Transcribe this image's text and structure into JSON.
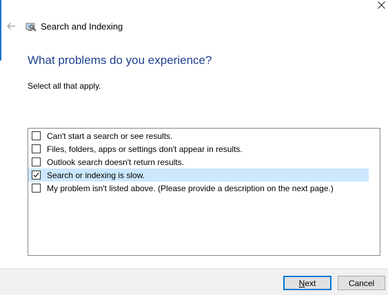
{
  "window": {
    "title": "Search and Indexing",
    "close_icon": "close-icon",
    "back_icon": "back-arrow-icon",
    "app_icon": "troubleshooter-icon",
    "accent_color": "#1a73c8"
  },
  "page": {
    "heading": "What problems do you experience?",
    "heading_color": "#1e3f8f",
    "instruction": "Select all that apply."
  },
  "problems": [
    {
      "label": "Can't start a search or see results.",
      "checked": false
    },
    {
      "label": "Files, folders, apps or settings don't appear in results.",
      "checked": false
    },
    {
      "label": "Outlook search doesn't return results.",
      "checked": false
    },
    {
      "label": "Search or indexing is slow.",
      "checked": true
    },
    {
      "label": "My problem isn't listed above. (Please provide a description on the next page.)",
      "checked": false
    }
  ],
  "buttons": {
    "next_mnemonic": "N",
    "next_rest": "ext",
    "cancel": "Cancel"
  }
}
